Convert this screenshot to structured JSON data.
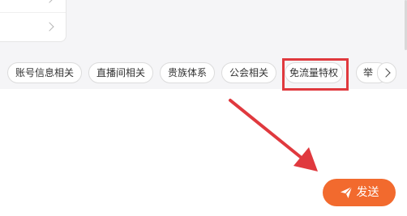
{
  "tags": {
    "items": [
      {
        "label": "账号信息相关"
      },
      {
        "label": "直播间相关"
      },
      {
        "label": "贵族体系"
      },
      {
        "label": "公会相关"
      },
      {
        "label": "免流量特权"
      },
      {
        "label": "举"
      }
    ],
    "highlighted_item": "免流量特权"
  },
  "composer": {
    "send_label": "发送",
    "send_color": "#f26a2e"
  },
  "annotation": {
    "color": "#e0393e"
  }
}
